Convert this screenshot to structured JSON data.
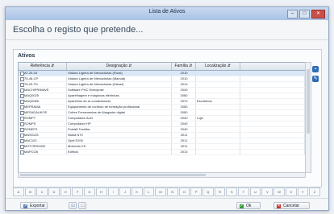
{
  "window": {
    "title": "Lista de Ativos",
    "controls": {
      "minimize": "–",
      "maximize": "□",
      "close": "✕"
    }
  },
  "heading": "Escolha o registo que pretende...",
  "search_link": "",
  "panel": {
    "title": "Ativos",
    "columns": [
      "Referência ⇵",
      "Designação ⇵",
      "Família ⇵",
      "Localização ⇵"
    ],
    "rows": [
      {
        "ref": "AT-25-04",
        "design": "Viatura Ligeira de Mercadorias (Rural)",
        "family": "2010",
        "location": "",
        "selected": true
      },
      {
        "ref": "75-48-CP",
        "design": "Viatura Ligeira de Mercadorias (Manual)",
        "family": "2010",
        "location": ""
      },
      {
        "ref": "78-29-TD",
        "design": "Viatura Ligeira de Mercadorias (Diesel)",
        "family": "2010",
        "location": ""
      },
      {
        "ref": "MACHIPRIMAVE",
        "design": "Software PHC Enterprise",
        "family": "2040",
        "location": ""
      },
      {
        "ref": "MAQ0025",
        "design": "Aparelhagem e máquinas eléctricas",
        "family": "2060",
        "location": ""
      },
      {
        "ref": "MAQ0085",
        "design": "Aparelhos de ar condicionado",
        "family": "2070",
        "location": "Escritórios"
      },
      {
        "ref": "MEPRAMA",
        "design": "Equipamento de controlo de formação profissional",
        "family": "2050",
        "location": ""
      },
      {
        "ref": "MESADAUKOS",
        "design": "Cofres Ferramentas de Alargador digital",
        "family": "2050",
        "location": ""
      },
      {
        "ref": "SOMPT",
        "design": "Computador Acer",
        "family": "2040",
        "location": "Loja"
      },
      {
        "ref": "SOMPS",
        "design": "Computador HP",
        "family": "2040",
        "location": ""
      },
      {
        "ref": "SONEFS",
        "design": "Portátil Toshiba",
        "family": "2040",
        "location": ""
      },
      {
        "ref": "MAS0125",
        "design": "Nokia N70",
        "family": "2011",
        "location": ""
      },
      {
        "ref": "MAC102",
        "design": "Opel E200",
        "family": "2011",
        "location": ""
      },
      {
        "ref": "MOTORS0432",
        "design": "Motorola C8",
        "family": "2011",
        "location": ""
      },
      {
        "ref": "MAPCO8",
        "design": "Edifício",
        "family": "2013",
        "location": ""
      }
    ]
  },
  "letters": [
    "A",
    "B",
    "C",
    "D",
    "E",
    "F",
    "G",
    "H",
    "I",
    "J",
    "K",
    "L",
    "M",
    "N",
    "O",
    "P",
    "Q",
    "R",
    "S",
    "T",
    "U",
    "V",
    "W",
    "X",
    "Y",
    "Z"
  ],
  "buttons": {
    "export": "Exportar",
    "ok": "Ok",
    "cancel": "Cancelar"
  }
}
